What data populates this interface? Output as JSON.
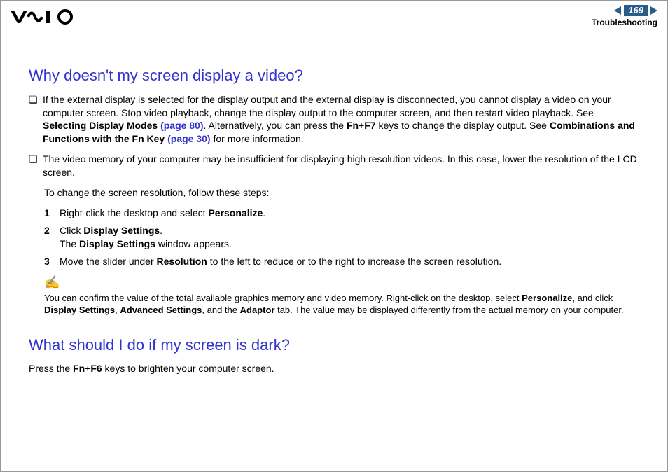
{
  "header": {
    "page_number": "169",
    "section": "Troubleshooting"
  },
  "q1": {
    "title": "Why doesn't my screen display a video?",
    "b1_pre": "If the external display is selected for the display output and the external display is disconnected, you cannot display a video on your computer screen. Stop video playback, change the display output to the computer screen, and then restart video playback. See ",
    "b1_bold1": "Selecting Display Modes",
    "b1_link1": "(page 80)",
    "b1_mid": ". Alternatively, you can press the ",
    "b1_fn": "Fn",
    "b1_plus": "+",
    "b1_f7": "F7",
    "b1_mid2": " keys to change the display output. See ",
    "b1_bold2": "Combinations and Functions with the Fn Key",
    "b1_link2": "(page 30)",
    "b1_end": " for more information.",
    "b2": "The video memory of your computer may be insufficient for displaying high resolution videos. In this case, lower the resolution of the LCD screen.",
    "steps_lead": "To change the screen resolution, follow these steps:",
    "s1_pre": "Right-click the desktop and select ",
    "s1_bold": "Personalize",
    "s1_end": ".",
    "s2_pre": "Click ",
    "s2_bold1": "Display Settings",
    "s2_mid": ".",
    "s2_line2_pre": "The ",
    "s2_line2_bold": "Display Settings",
    "s2_line2_end": " window appears.",
    "s3_pre": "Move the slider under ",
    "s3_bold": "Resolution",
    "s3_end": " to the left to reduce or to the right to increase the screen resolution.",
    "note_sym": "✍",
    "note_pre": "You can confirm the value of the total available graphics memory and video memory. Right-click on the desktop, select ",
    "note_b1": "Personalize",
    "note_m1": ", and click ",
    "note_b2": "Display Settings",
    "note_m2": ", ",
    "note_b3": "Advanced Settings",
    "note_m3": ", and the ",
    "note_b4": "Adaptor",
    "note_end": " tab. The value may be displayed differently from the actual memory on your computer."
  },
  "q2": {
    "title": "What should I do if my screen is dark?",
    "p_pre": "Press the ",
    "p_fn": "Fn",
    "p_plus": "+",
    "p_f6": "F6",
    "p_end": " keys to brighten your computer screen."
  }
}
